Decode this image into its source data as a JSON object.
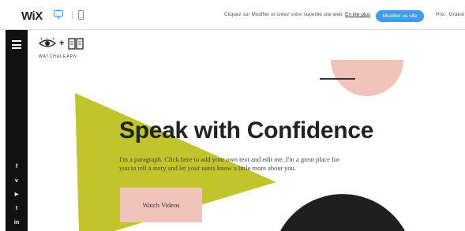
{
  "topbar": {
    "logo": "WiX",
    "promo_text": "Cliquez sur Modifier et créez votre superbe site web",
    "promo_link": "En lire plus",
    "modify_button": "Modifier ce site",
    "price": "Prix : Gratuit"
  },
  "sidebar": {
    "social": [
      "f",
      "v",
      "▶",
      "t",
      "in"
    ]
  },
  "site": {
    "brand_name": "WATCH&LEARN",
    "headline": "Speak with Confidence",
    "paragraph": "I'm a paragraph. Click here to add your own text and edit me. I'm a great place for you to tell a story and let your users know a little more about you.",
    "cta": "Watch Videos"
  },
  "colors": {
    "triangle": "#c1c42a",
    "circle_pink": "#f0c4ba",
    "circle_dark": "#1f1f1f",
    "wix_blue": "#3d9bf2"
  }
}
